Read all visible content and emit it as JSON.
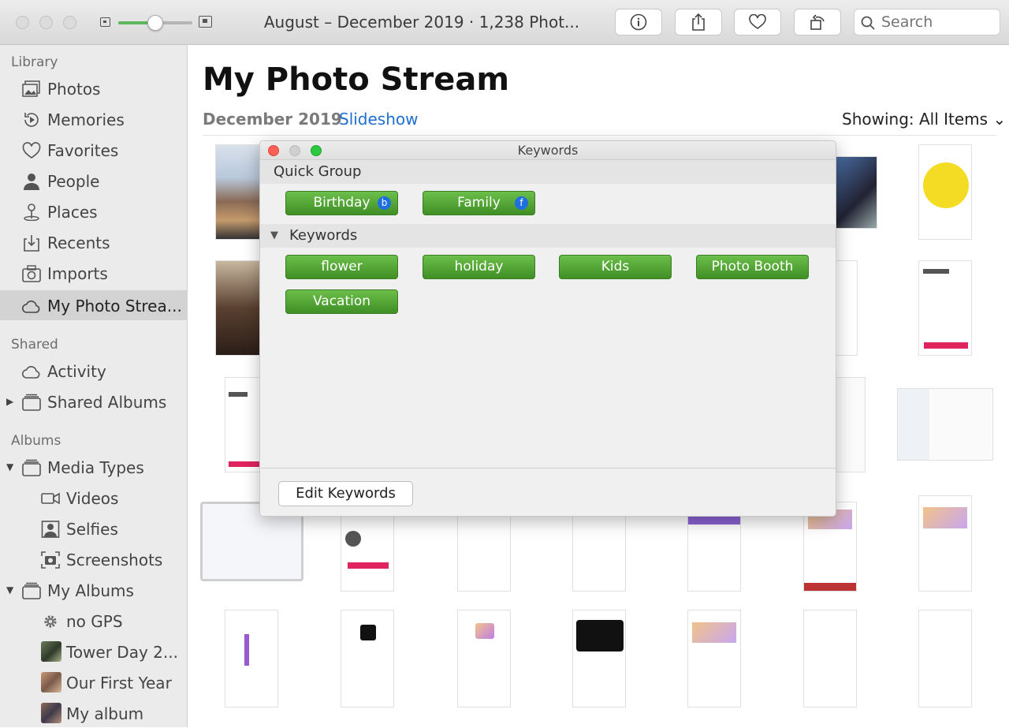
{
  "window": {
    "title": "August – December 2019 · 1,238 Phot..."
  },
  "toolbar": {
    "search_placeholder": "Search",
    "zoom_level": 0.5
  },
  "sidebar": {
    "library_header": "Library",
    "library": [
      "Photos",
      "Memories",
      "Favorites",
      "People",
      "Places",
      "Recents",
      "Imports",
      "My Photo Strea..."
    ],
    "shared_header": "Shared",
    "shared": [
      "Activity",
      "Shared Albums"
    ],
    "albums_header": "Albums",
    "albums": [
      "Media Types",
      "Videos",
      "Selfies",
      "Screenshots",
      "My Albums",
      "no GPS",
      "Tower Day 2...",
      "Our First Year",
      "My album"
    ]
  },
  "main": {
    "title": "My Photo Stream",
    "date": "December 2019",
    "slideshow": "Slideshow",
    "showing": "Showing: All Items"
  },
  "keywords_panel": {
    "title": "Keywords",
    "quick_group_header": "Quick Group",
    "quick_group": [
      {
        "label": "Birthday",
        "shortcut": "b"
      },
      {
        "label": "Family",
        "shortcut": "f"
      }
    ],
    "keywords_header": "Keywords",
    "keywords": [
      "flower",
      "holiday",
      "Kids",
      "Photo Booth",
      "Vacation"
    ],
    "edit_button": "Edit Keywords"
  },
  "colors": {
    "accent": "#1f6fd1",
    "tag_green": "#4ea52f",
    "slider_fill": "#5cb85c"
  }
}
